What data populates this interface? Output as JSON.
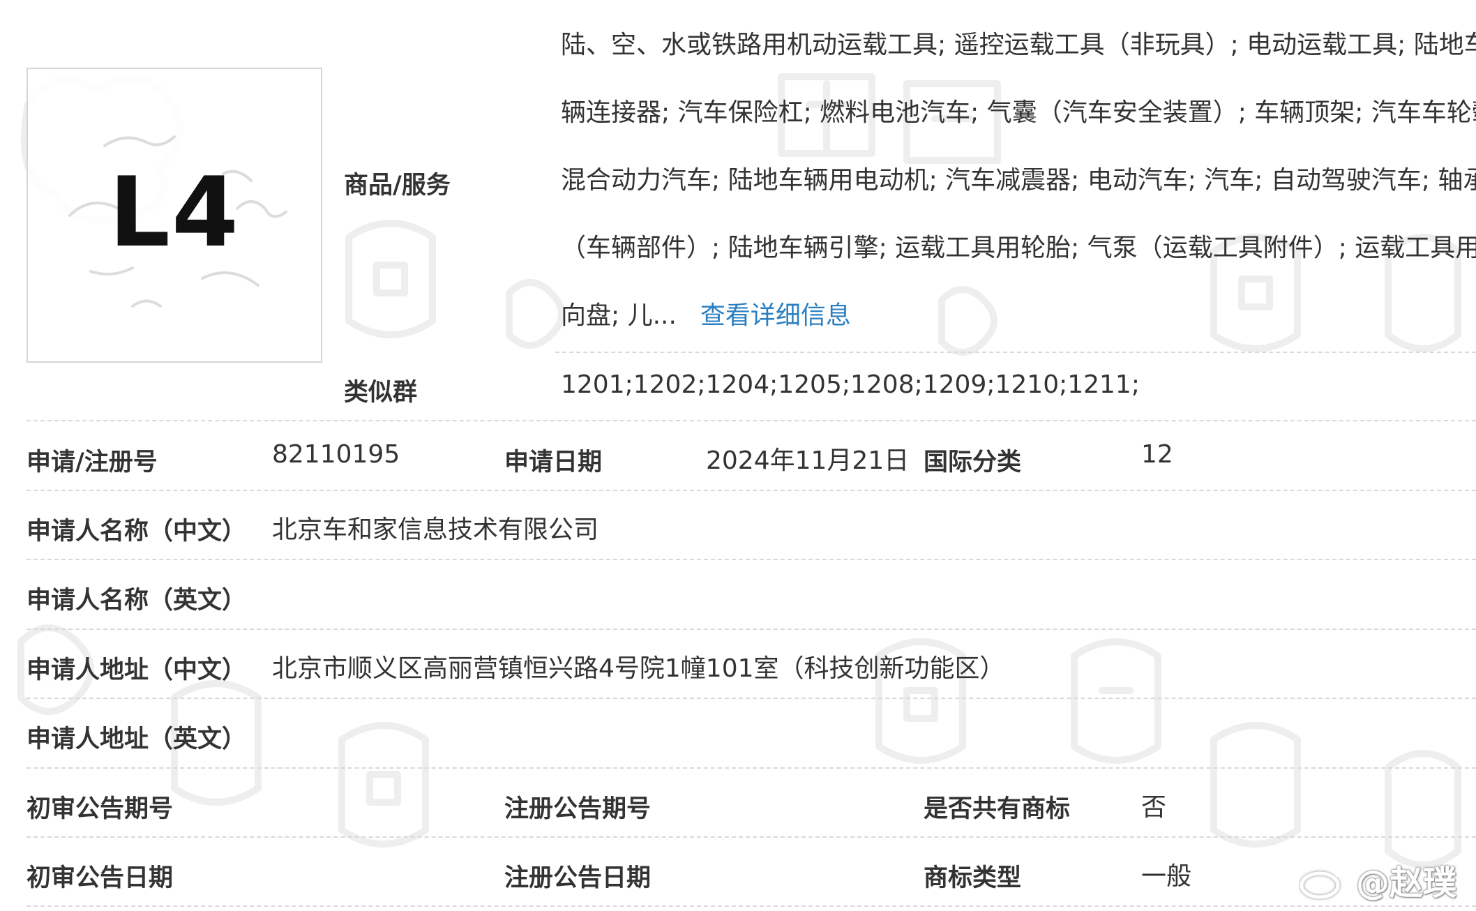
{
  "logo": {
    "text": "L4"
  },
  "goods": {
    "label": "商品/服务",
    "lines": [
      "陆、空、水或铁路用机动运载工具; 遥控运载工具（非玩具）; 电动运载工具; 陆地车",
      "辆连接器; 汽车保险杠; 燃料电池汽车; 气囊（汽车安全装置）; 车辆顶架; 汽车车轮毂;",
      "混合动力汽车; 陆地车辆用电动机; 汽车减震器; 电动汽车; 汽车; 自动驾驶汽车; 轴承",
      "（车辆部件）; 陆地车辆引擎; 运载工具用轮胎; 气泵（运载工具附件）; 运载工具用方",
      "向盘; 儿..."
    ],
    "more_link": "查看详细信息"
  },
  "similar_group": {
    "label": "类似群",
    "value": "1201;1202;1204;1205;1208;1209;1210;1211;"
  },
  "reg_number": {
    "label": "申请/注册号",
    "value": "82110195"
  },
  "apply_date": {
    "label": "申请日期",
    "value": "2024年11月21日"
  },
  "intl_class": {
    "label": "国际分类",
    "value": "12"
  },
  "applicant_cn": {
    "label": "申请人名称（中文）",
    "value": "北京车和家信息技术有限公司"
  },
  "applicant_en": {
    "label": "申请人名称（英文）",
    "value": ""
  },
  "address_cn": {
    "label": "申请人地址（中文）",
    "value": "北京市顺义区高丽营镇恒兴路4号院1幢101室（科技创新功能区）"
  },
  "address_en": {
    "label": "申请人地址（英文）",
    "value": ""
  },
  "prelim_issue": {
    "label": "初审公告期号",
    "value": ""
  },
  "reg_issue": {
    "label": "注册公告期号",
    "value": ""
  },
  "shared_mark": {
    "label": "是否共有商标",
    "value": "否"
  },
  "prelim_date": {
    "label": "初审公告日期",
    "value": ""
  },
  "reg_date": {
    "label": "注册公告日期",
    "value": ""
  },
  "mark_type": {
    "label": "商标类型",
    "value": "一般"
  },
  "weibo": {
    "handle": "@赵璞"
  },
  "colors": {
    "link": "#2a7fc1",
    "text": "#333333",
    "divider": "#d9d9d9",
    "watermark": "#eeeeee"
  }
}
